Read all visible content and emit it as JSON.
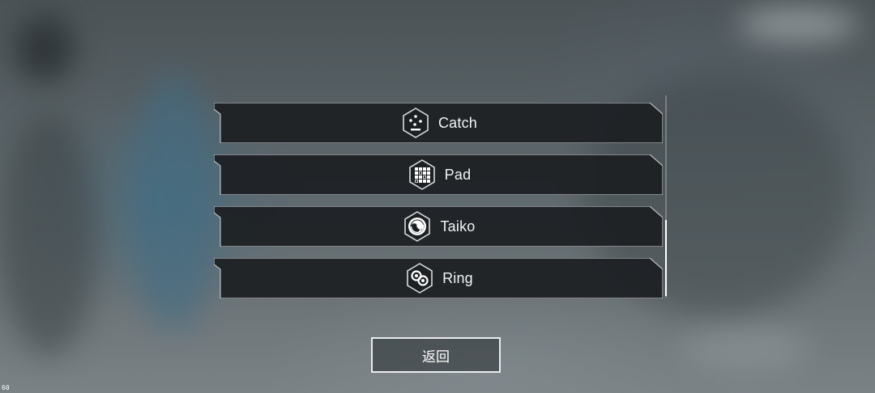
{
  "mode_list": {
    "items": [
      {
        "label": "Catch",
        "icon": "catch-mode-icon"
      },
      {
        "label": "Pad",
        "icon": "pad-mode-icon"
      },
      {
        "label": "Taiko",
        "icon": "taiko-mode-icon"
      },
      {
        "label": "Ring",
        "icon": "ring-mode-icon"
      }
    ],
    "scroll_position": 0.6
  },
  "back_button": {
    "label": "返回"
  },
  "fps_counter": "60",
  "colors": {
    "panel": "#25292c",
    "panel_border": "#b9bec1",
    "text": "#f2f4f5",
    "icon_border": "#d8dcde"
  }
}
